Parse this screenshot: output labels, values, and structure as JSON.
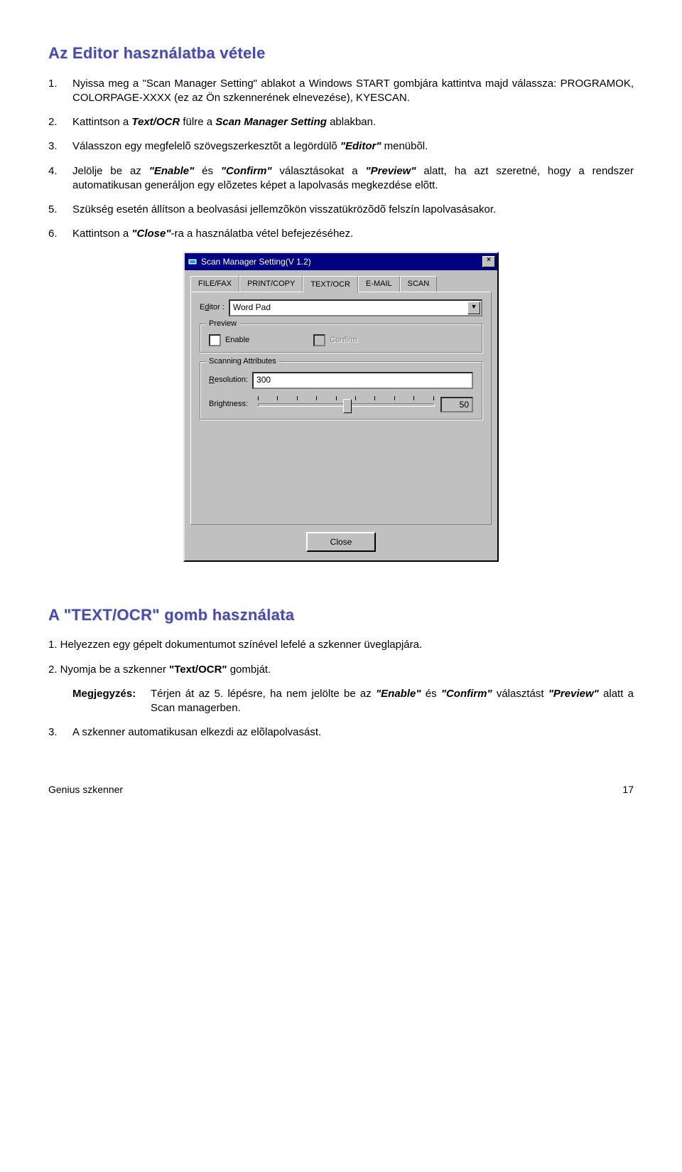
{
  "heading1": "Az Editor használatba vétele",
  "steps1": {
    "s1": "Nyissa meg a \"Scan Manager Setting\" ablakot a Windows START gombjára kattintva majd válassza: PROGRAMOK, COLORPAGE-XXXX (ez az Ön szkennerének elnevezése), KYESCAN.",
    "s2_a": "Kattintson a ",
    "s2_b": " fülre a ",
    "s2_c": " ablakban.",
    "s2_i1": "Text/OCR",
    "s2_i2": "Scan Manager Setting",
    "s3_a": "Válasszon egy megfelelõ szövegszerkesztõt a legördülõ ",
    "s3_b": " menübõl.",
    "s3_i": "\"Editor\"",
    "s4_a": "Jelölje be az ",
    "s4_b": " és ",
    "s4_c": " választásokat a ",
    "s4_d": " alatt, ha azt szeretné, hogy a rendszer automatikusan generáljon egy elõzetes képet a lapolvasás megkezdése elõtt.",
    "s4_i1": "\"Enable\"",
    "s4_i2": "\"Confirm\"",
    "s4_i3": "\"Preview\"",
    "s5": "Szükség esetén állítson a beolvasási jellemzõkön visszatükrözõdõ felszín lapolvasásakor.",
    "s6_a": "Kattintson a ",
    "s6_b": "-ra a használatba vétel befejezéséhez.",
    "s6_i": "\"Close\""
  },
  "dialog": {
    "title": "Scan Manager Setting(V 1.2)",
    "tabs": [
      "FILE/FAX",
      "PRINT/COPY",
      "TEXT/OCR",
      "E-MAIL",
      "SCAN"
    ],
    "editor_label_pre": "E",
    "editor_label_ul": "d",
    "editor_label_post": "itor :",
    "editor_value": "Word Pad",
    "preview_group": "Preview",
    "enable_label": "Enable",
    "enable_ul": "E",
    "enable_rest": "nable",
    "confirm_label": "Confirm",
    "confirm_ul": "C",
    "confirm_rest": "onfirm",
    "scan_group": "Scanning Attributes",
    "res_label_ul": "R",
    "res_label_rest": "esolution:",
    "res_value": "300",
    "bright_label": "Brightness:",
    "bright_value": "50",
    "close_btn": "Close"
  },
  "heading2": "A \"TEXT/OCR\" gomb használata",
  "steps2": {
    "s1": "1. Helyezzen egy gépelt dokumentumot színével lefelé a szkenner üveglapjára.",
    "s2_a": "2. Nyomja be a szkenner ",
    "s2_b": " gombját.",
    "s2_i": "\"Text/OCR\"",
    "note_label": "Megjegyzés:",
    "note_a": "Térjen át az 5. lépésre, ha nem jelölte be az ",
    "note_b": " és ",
    "note_c": " választást ",
    "note_d": " alatt a Scan managerben.",
    "note_i1": "\"Enable\"",
    "note_i2": "\"Confirm\"",
    "note_i3": "\"Preview\"",
    "s3": "A szkenner automatikusan elkezdi az elõlapolvasást."
  },
  "footer_left": "Genius szkenner",
  "footer_right": "17"
}
